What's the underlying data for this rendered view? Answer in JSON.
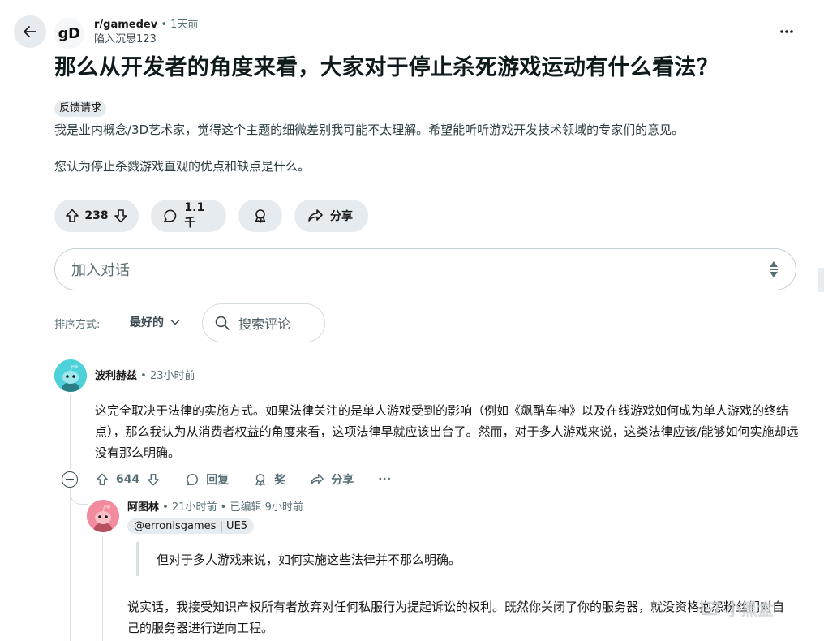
{
  "subreddit": {
    "name": "r/gamedev",
    "time": "1天前",
    "author": "陷入沉思123",
    "avatar_text": "gD"
  },
  "post": {
    "title": "那么从开发者的角度来看，大家对于停止杀死游戏运动有什么看法？",
    "flair": "反馈请求",
    "body_p1": "我是业内概念/3D艺术家，觉得这个主题的细微差别我可能不太理解。希望能听听游戏开发技术领域的专家们的意见。",
    "body_p2": "您认为停止杀戮游戏直观的优点和缺点是什么。"
  },
  "actions": {
    "votes": "238",
    "comments": "1.1千",
    "share": "分享"
  },
  "comment_input": {
    "placeholder": "加入对话"
  },
  "sort": {
    "label": "排序方式:",
    "value": "最好的"
  },
  "search": {
    "placeholder": "搜索评论"
  },
  "comments": [
    {
      "username": "波利赫兹",
      "time": "23小时前",
      "body": "这完全取决于法律的实施方式。如果法律关注的是单人游戏受到的影响（例如《飙酷车神》以及在线游戏如何成为单人游戏的终结点），那么我认为从消费者权益的角度来看，这项法律早就应该出台了。然而，对于多人游戏来说，这类法律应该/能够如何实施却远没有那么明确。",
      "votes": "644",
      "reply_label": "回复",
      "award_label": "奖",
      "share_label": "分享",
      "more": "···"
    },
    {
      "username": "阿图林",
      "time": "21小时前",
      "edited": "已编辑 9小时前",
      "flair": "@erronisgames | UE5",
      "quote": "但对于多人游戏来说，如何实施这些法律并不那么明确。",
      "body": "说实话，我接受知识产权所有者放弃对任何私服行为提起诉讼的权利。既然你关闭了你的服务器，就没资格抱怨粉丝们对自己的服务器进行逆向工程。"
    }
  ],
  "watermark": "小黑盒",
  "colors": {
    "accent_bg": "#e5ebee",
    "avatar1": "#4fd1d9",
    "avatar2": "#f28b9b",
    "muted": "#576f76"
  }
}
